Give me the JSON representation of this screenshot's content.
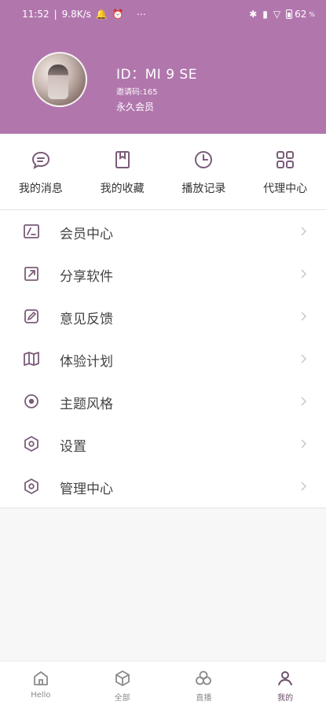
{
  "status_bar": {
    "time": "11:52",
    "speed": "9.8K/s",
    "battery": "62",
    "battery_unit": "%",
    "icons": [
      "bell-icon",
      "alarm-icon",
      "more-icon",
      "bluetooth-icon",
      "signal-icon",
      "wifi-icon",
      "battery-icon"
    ]
  },
  "profile": {
    "id_label": "ID：MI 9 SE",
    "invite_code": "邀请码:165",
    "membership": "永久会员"
  },
  "quick_actions": [
    {
      "label": "我的消息",
      "icon": "message-icon"
    },
    {
      "label": "我的收藏",
      "icon": "bookmark-icon"
    },
    {
      "label": "播放记录",
      "icon": "clock-icon"
    },
    {
      "label": "代理中心",
      "icon": "grid-icon"
    }
  ],
  "menu": [
    {
      "label": "会员中心",
      "icon": "vip-card-icon"
    },
    {
      "label": "分享软件",
      "icon": "share-icon"
    },
    {
      "label": "意见反馈",
      "icon": "edit-icon"
    },
    {
      "label": "体验计划",
      "icon": "map-icon"
    },
    {
      "label": "主题风格",
      "icon": "theme-icon"
    },
    {
      "label": "设置",
      "icon": "settings-icon"
    },
    {
      "label": "管理中心",
      "icon": "admin-icon"
    }
  ],
  "tabs": [
    {
      "label": "Hello",
      "icon": "home-icon"
    },
    {
      "label": "全部",
      "icon": "cube-icon"
    },
    {
      "label": "直播",
      "icon": "circles-icon"
    },
    {
      "label": "我的",
      "icon": "user-icon",
      "active": true
    }
  ],
  "colors": {
    "accent": "#b177ad",
    "icon": "#7a5c79",
    "active_tab": "#6a4f69"
  }
}
